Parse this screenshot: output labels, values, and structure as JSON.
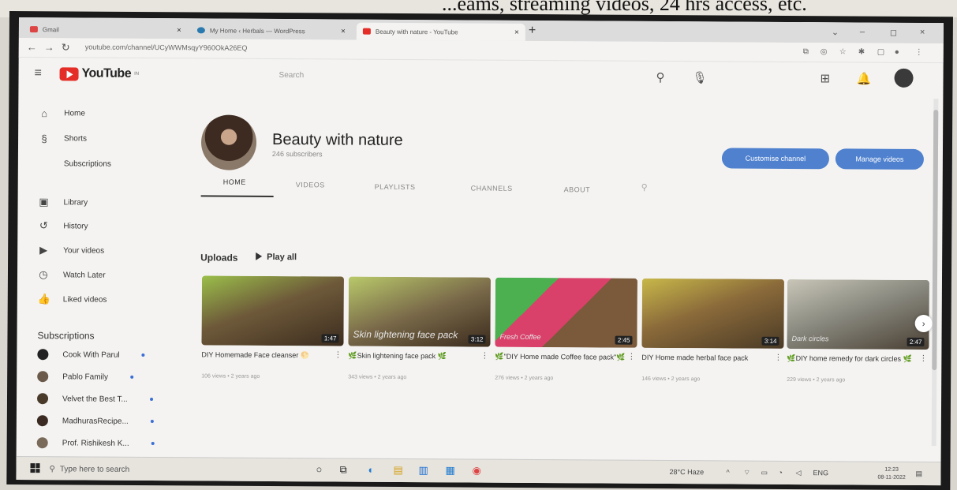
{
  "photo_caption": "...eams, streaming videos, 24 hrs access, etc.",
  "browser": {
    "tabs": [
      {
        "label": "Gmail",
        "active": false
      },
      {
        "label": "My Home ‹ Herbals — WordPress",
        "active": false
      },
      {
        "label": "Beauty with nature - YouTube",
        "active": true
      }
    ],
    "url": "youtube.com/channel/UCyWWMsqyY960OkA26EQ",
    "newtab": "+",
    "close_glyph": "×",
    "win_min": "–",
    "win_max": "◻",
    "win_close": "×",
    "win_chevron": "⌄"
  },
  "youtube": {
    "logo_text": "YouTube",
    "logo_region": "IN",
    "search_placeholder": "Search"
  },
  "sidebar": {
    "items": [
      {
        "icon": "home-icon",
        "glyph": "⌂",
        "label": "Home"
      },
      {
        "icon": "shorts-icon",
        "glyph": "§",
        "label": "Shorts"
      },
      {
        "icon": "subscriptions-icon",
        "glyph": "",
        "label": "Subscriptions"
      },
      {
        "icon": "library-icon",
        "glyph": "▣",
        "label": "Library"
      },
      {
        "icon": "history-icon",
        "glyph": "↺",
        "label": "History"
      },
      {
        "icon": "your-videos-icon",
        "glyph": "▶",
        "label": "Your videos"
      },
      {
        "icon": "watch-later-icon",
        "glyph": "◷",
        "label": "Watch Later"
      },
      {
        "icon": "liked-videos-icon",
        "glyph": "👍",
        "label": "Liked videos"
      }
    ],
    "subscriptions_header": "Subscriptions",
    "subscriptions": [
      {
        "label": "Cook With Parul"
      },
      {
        "label": "Pablo Family"
      },
      {
        "label": "Velvet the Best T..."
      },
      {
        "label": "MadhurasRecipe..."
      },
      {
        "label": "Prof. Rishikesh K..."
      }
    ]
  },
  "channel": {
    "name": "Beauty with nature",
    "subscribers": "246 subscribers",
    "customise_button": "Customise channel",
    "manage_button": "Manage videos",
    "tabs": [
      "HOME",
      "VIDEOS",
      "PLAYLISTS",
      "CHANNELS",
      "ABOUT"
    ],
    "active_tab": "HOME"
  },
  "uploads": {
    "heading": "Uploads",
    "play_all": "Play all",
    "videos": [
      {
        "title": "DIY Homemade Face cleanser 🌕",
        "meta": "106 views • 2 years ago",
        "duration": "1:47",
        "overlay": "",
        "colors": [
          "#6e5a3a",
          "#9bbf4a",
          "#3c2c1e"
        ]
      },
      {
        "title": "🌿Skin lightening face pack 🌿",
        "meta": "343 views • 2 years ago",
        "duration": "3:12",
        "overlay": "Skin lightening face pack",
        "colors": [
          "#7a6a4a",
          "#b9c96a",
          "#3a2a1c"
        ]
      },
      {
        "title": "🌿\"DIY Home made Coffee face pack\"🌿",
        "meta": "276 views • 2 years ago",
        "duration": "2:45",
        "overlay": "Fresh Coffee",
        "colors": [
          "#d9406a",
          "#4caf50",
          "#7a5a3a"
        ]
      },
      {
        "title": "DIY Home made herbal face pack",
        "meta": "146 views • 2 years ago",
        "duration": "3:14",
        "overlay": "",
        "colors": [
          "#8a6a3a",
          "#c8b84a",
          "#4a3a26"
        ]
      },
      {
        "title": "🌿DIY home remedy for dark circles 🌿",
        "meta": "229 views • 2 years ago",
        "duration": "2:47",
        "overlay": "Dark circles",
        "colors": [
          "#8a8a80",
          "#c9c6b8",
          "#4a3f33"
        ]
      }
    ]
  },
  "taskbar": {
    "search_placeholder": "Type here to search",
    "weather": "28°C Haze",
    "language": "ENG",
    "time": "12:23",
    "date": "08-11-2022"
  },
  "colors": {
    "accent": "#4f81cf",
    "youtube_red": "#e52d27"
  }
}
